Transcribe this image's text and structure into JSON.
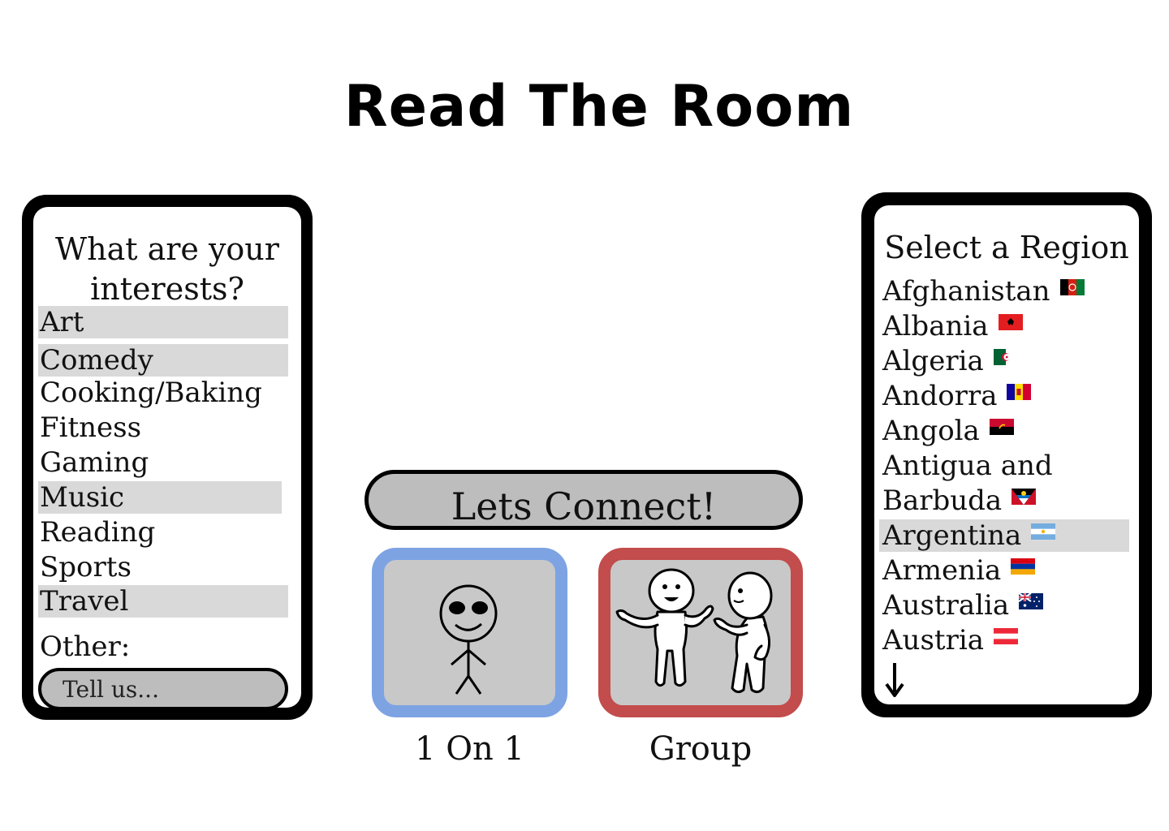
{
  "app": {
    "title": "Read The Room"
  },
  "interests": {
    "heading_line1": "What are your",
    "heading_line2": "interests?",
    "items": [
      {
        "label": "Art",
        "selected": true
      },
      {
        "label": "Comedy",
        "selected": true
      },
      {
        "label": "Cooking/Baking",
        "selected": false
      },
      {
        "label": "Fitness",
        "selected": false
      },
      {
        "label": "Gaming",
        "selected": false
      },
      {
        "label": "Music",
        "selected": true
      },
      {
        "label": "Reading",
        "selected": false
      },
      {
        "label": "Sports",
        "selected": false
      },
      {
        "label": "Travel",
        "selected": true
      }
    ],
    "other_label": "Other:",
    "other_placeholder": "Tell us..."
  },
  "connect": {
    "button_label": "Lets Connect!",
    "modes": [
      {
        "label": "1 On 1",
        "icon": "single-stick-figure-icon",
        "border_color": "#7da3e3"
      },
      {
        "label": "Group",
        "icon": "two-people-talking-icon",
        "border_color": "#c34c4c"
      }
    ]
  },
  "region": {
    "heading": "Select a Region",
    "items": [
      {
        "label": "Afghanistan",
        "flag": "afghanistan-flag-icon",
        "selected": false
      },
      {
        "label": "Albania",
        "flag": "albania-flag-icon",
        "selected": false
      },
      {
        "label": "Algeria",
        "flag": "algeria-flag-icon",
        "selected": false
      },
      {
        "label": "Andorra",
        "flag": "andorra-flag-icon",
        "selected": false
      },
      {
        "label": "Angola",
        "flag": "angola-flag-icon",
        "selected": false
      },
      {
        "label": "Antigua and",
        "flag": "",
        "selected": false
      },
      {
        "label": "Barbuda",
        "flag": "antigua-barbuda-flag-icon",
        "selected": false
      },
      {
        "label": "Argentina",
        "flag": "argentina-flag-icon",
        "selected": true
      },
      {
        "label": "Armenia",
        "flag": "armenia-flag-icon",
        "selected": false
      },
      {
        "label": "Australia",
        "flag": "australia-flag-icon",
        "selected": false
      },
      {
        "label": "Austria",
        "flag": "austria-flag-icon",
        "selected": false
      }
    ],
    "scroll_icon": "arrow-down-icon"
  }
}
